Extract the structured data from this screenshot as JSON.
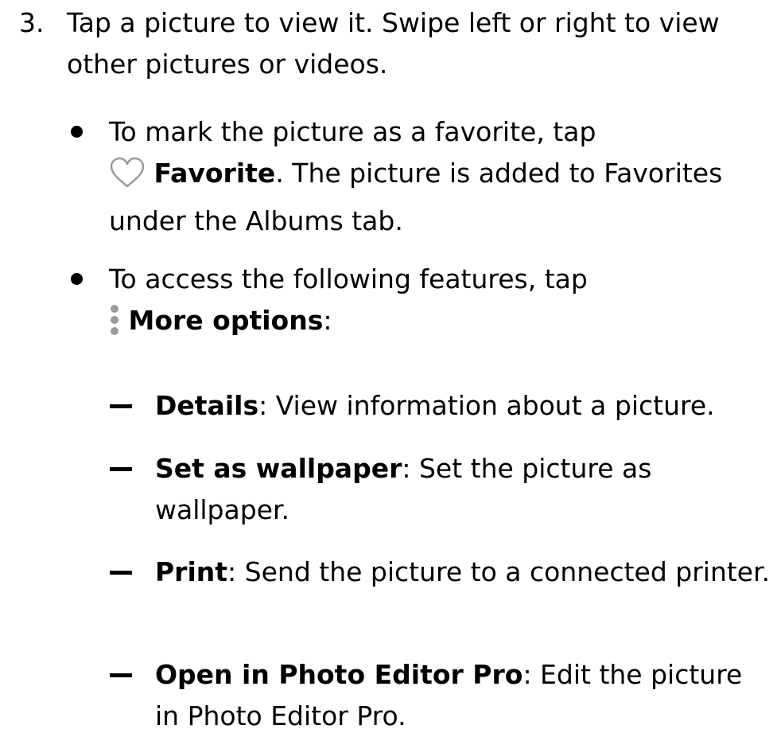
{
  "step": {
    "number": "3.",
    "text": "Tap a picture to view it. Swipe left or right to view other pictures or videos."
  },
  "bullets": [
    {
      "icon": "heart-outline-icon",
      "pre": "To mark the picture as a favorite, tap ",
      "bold": "Favorite",
      "post": ". The picture is added to Favorites under the Albums tab."
    },
    {
      "icon": "more-options-icon",
      "pre": "To access the following features, tap ",
      "bold": "More options",
      "post": ":"
    }
  ],
  "options": [
    {
      "bold": "Details",
      "text": ": View information about a picture."
    },
    {
      "bold": "Set as wallpaper",
      "text": ": Set the picture as wallpaper."
    },
    {
      "bold": "Print",
      "text": ": Send the picture to a connected printer."
    },
    {
      "bold": "Open in Photo Editor Pro",
      "text": ": Edit the picture in Photo Editor Pro."
    }
  ],
  "colors": {
    "text": "#000000",
    "icon_gray": "#9a9a9a"
  }
}
